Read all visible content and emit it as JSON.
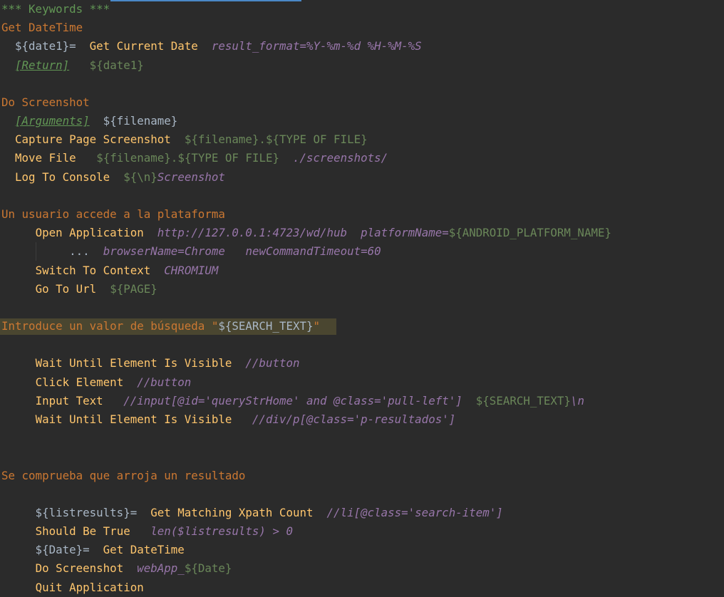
{
  "editor": {
    "lines": [
      {
        "name": "section-header-keywords",
        "segments": [
          {
            "text": "*** Keywords ***",
            "cls": "c-section"
          }
        ]
      },
      {
        "name": "keyword-get-datetime",
        "segments": [
          {
            "text": "Get DateTime",
            "cls": "c-kw"
          }
        ]
      },
      {
        "name": "line-date1-assign",
        "segments": [
          {
            "text": "  ${date1}=  ",
            "cls": "c-var"
          },
          {
            "text": "Get Current Date",
            "cls": "c-call"
          },
          {
            "text": "  ",
            "cls": "c-var"
          },
          {
            "text": "result_format=%Y-%m-%d %H-%M-%S",
            "cls": "c-arg"
          }
        ]
      },
      {
        "name": "line-return",
        "segments": [
          {
            "text": "  ",
            "cls": "c-var"
          },
          {
            "text": "[Return]",
            "cls": "c-setting"
          },
          {
            "text": "   ",
            "cls": "c-var"
          },
          {
            "text": "${date1}",
            "cls": "c-varg"
          }
        ]
      },
      {
        "name": "blank-1",
        "segments": [
          {
            "text": "",
            "cls": "c-var"
          }
        ]
      },
      {
        "name": "keyword-do-screenshot",
        "segments": [
          {
            "text": "Do Screenshot",
            "cls": "c-kw"
          }
        ]
      },
      {
        "name": "line-arguments",
        "segments": [
          {
            "text": "  ",
            "cls": "c-var"
          },
          {
            "text": "[Arguments]",
            "cls": "c-setting"
          },
          {
            "text": "  ${filename}",
            "cls": "c-var"
          }
        ]
      },
      {
        "name": "line-capture-page-screenshot",
        "segments": [
          {
            "text": "  ",
            "cls": "c-var"
          },
          {
            "text": "Capture Page Screenshot",
            "cls": "c-call"
          },
          {
            "text": "  ",
            "cls": "c-var"
          },
          {
            "text": "${filename}.${TYPE OF FILE}",
            "cls": "c-varg"
          }
        ]
      },
      {
        "name": "line-move-file",
        "segments": [
          {
            "text": "  ",
            "cls": "c-var"
          },
          {
            "text": "Move File",
            "cls": "c-call"
          },
          {
            "text": "   ",
            "cls": "c-var"
          },
          {
            "text": "${filename}.${TYPE OF FILE}",
            "cls": "c-varg"
          },
          {
            "text": "  ",
            "cls": "c-var"
          },
          {
            "text": "./screenshots/",
            "cls": "c-arg"
          }
        ]
      },
      {
        "name": "line-log-to-console",
        "segments": [
          {
            "text": "  ",
            "cls": "c-var"
          },
          {
            "text": "Log To Console",
            "cls": "c-call"
          },
          {
            "text": "  ",
            "cls": "c-var"
          },
          {
            "text": "${\\n}",
            "cls": "c-varg"
          },
          {
            "text": "Screenshot",
            "cls": "c-arg"
          }
        ]
      },
      {
        "name": "blank-2",
        "segments": [
          {
            "text": "",
            "cls": "c-var"
          }
        ]
      },
      {
        "name": "keyword-usuario-accede",
        "segments": [
          {
            "text": "Un usuario accede a la plataforma",
            "cls": "c-kw"
          }
        ]
      },
      {
        "name": "line-open-application",
        "segments": [
          {
            "text": "     ",
            "cls": "c-var"
          },
          {
            "text": "Open Application",
            "cls": "c-call"
          },
          {
            "text": "  ",
            "cls": "c-var"
          },
          {
            "text": "http://127.0.0.1:4723/wd/hub",
            "cls": "c-arg"
          },
          {
            "text": "  ",
            "cls": "c-var"
          },
          {
            "text": "platformName=",
            "cls": "c-arg"
          },
          {
            "text": "${ANDROID_PLATFORM_NAME}",
            "cls": "c-varg"
          }
        ]
      },
      {
        "name": "line-continuation",
        "segments": [
          {
            "text": "          ",
            "cls": "c-var"
          },
          {
            "text": "...",
            "cls": "c-ellipsis"
          },
          {
            "text": "  ",
            "cls": "c-var"
          },
          {
            "text": "browserName=Chrome",
            "cls": "c-arg"
          },
          {
            "text": "   ",
            "cls": "c-var"
          },
          {
            "text": "newCommandTimeout=60",
            "cls": "c-arg"
          }
        ]
      },
      {
        "name": "line-switch-context",
        "segments": [
          {
            "text": "     ",
            "cls": "c-var"
          },
          {
            "text": "Switch To Context",
            "cls": "c-call"
          },
          {
            "text": "  ",
            "cls": "c-var"
          },
          {
            "text": "CHROMIUM",
            "cls": "c-arg"
          }
        ]
      },
      {
        "name": "line-go-to-url",
        "segments": [
          {
            "text": "     ",
            "cls": "c-var"
          },
          {
            "text": "Go To Url",
            "cls": "c-call"
          },
          {
            "text": "  ",
            "cls": "c-var"
          },
          {
            "text": "${PAGE}",
            "cls": "c-varg"
          }
        ]
      },
      {
        "name": "blank-3",
        "segments": [
          {
            "text": "",
            "cls": "c-var"
          }
        ]
      },
      {
        "name": "keyword-introduce-valor",
        "segments": [
          {
            "text": "Introduce un valor de búsqueda \"",
            "cls": "c-kw"
          },
          {
            "text": "${SEARCH_TEXT}",
            "cls": "c-lit"
          },
          {
            "text": "\"",
            "cls": "c-kw"
          }
        ]
      },
      {
        "name": "blank-4",
        "segments": [
          {
            "text": "",
            "cls": "c-var"
          }
        ]
      },
      {
        "name": "line-wait-until-visible-1",
        "segments": [
          {
            "text": "     ",
            "cls": "c-var"
          },
          {
            "text": "Wait Until Element Is Visible",
            "cls": "c-call"
          },
          {
            "text": "  ",
            "cls": "c-var"
          },
          {
            "text": "//button",
            "cls": "c-arg"
          }
        ]
      },
      {
        "name": "line-click-element",
        "segments": [
          {
            "text": "     ",
            "cls": "c-var"
          },
          {
            "text": "Click Element",
            "cls": "c-call"
          },
          {
            "text": "  ",
            "cls": "c-var"
          },
          {
            "text": "//button",
            "cls": "c-arg"
          }
        ]
      },
      {
        "name": "line-input-text",
        "segments": [
          {
            "text": "     ",
            "cls": "c-var"
          },
          {
            "text": "Input Text",
            "cls": "c-call"
          },
          {
            "text": "   ",
            "cls": "c-var"
          },
          {
            "text": "//input[@id='queryStrHome' and @class='pull-left']",
            "cls": "c-arg"
          },
          {
            "text": "  ",
            "cls": "c-var"
          },
          {
            "text": "${SEARCH_TEXT}",
            "cls": "c-varg"
          },
          {
            "text": "\\n",
            "cls": "c-arg"
          }
        ]
      },
      {
        "name": "line-wait-until-visible-2",
        "segments": [
          {
            "text": "     ",
            "cls": "c-var"
          },
          {
            "text": "Wait Until Element Is Visible",
            "cls": "c-call"
          },
          {
            "text": "   ",
            "cls": "c-var"
          },
          {
            "text": "//div/p[@class='p-resultados']",
            "cls": "c-arg"
          }
        ]
      },
      {
        "name": "blank-5",
        "segments": [
          {
            "text": "",
            "cls": "c-var"
          }
        ]
      },
      {
        "name": "blank-6",
        "segments": [
          {
            "text": "",
            "cls": "c-var"
          }
        ]
      },
      {
        "name": "keyword-se-comprueba",
        "segments": [
          {
            "text": "Se comprueba que arroja un resultado",
            "cls": "c-kw"
          }
        ]
      },
      {
        "name": "blank-7",
        "segments": [
          {
            "text": "",
            "cls": "c-var"
          }
        ]
      },
      {
        "name": "line-listresults-assign",
        "segments": [
          {
            "text": "     ${listresults}=  ",
            "cls": "c-var"
          },
          {
            "text": "Get Matching Xpath Count",
            "cls": "c-call"
          },
          {
            "text": "  ",
            "cls": "c-var"
          },
          {
            "text": "//li[@class='search-item']",
            "cls": "c-arg"
          }
        ]
      },
      {
        "name": "line-should-be-true",
        "segments": [
          {
            "text": "     ",
            "cls": "c-var"
          },
          {
            "text": "Should Be True",
            "cls": "c-call"
          },
          {
            "text": "   ",
            "cls": "c-var"
          },
          {
            "text": "len($listresults) > 0",
            "cls": "c-arg"
          }
        ]
      },
      {
        "name": "line-date-assign",
        "segments": [
          {
            "text": "     ${Date}=  ",
            "cls": "c-var"
          },
          {
            "text": "Get DateTime",
            "cls": "c-call"
          }
        ]
      },
      {
        "name": "line-do-screenshot-call",
        "segments": [
          {
            "text": "     ",
            "cls": "c-var"
          },
          {
            "text": "Do Screenshot",
            "cls": "c-call"
          },
          {
            "text": "  ",
            "cls": "c-var"
          },
          {
            "text": "webApp_",
            "cls": "c-arg"
          },
          {
            "text": "${Date}",
            "cls": "c-varg"
          }
        ]
      },
      {
        "name": "line-quit-application",
        "segments": [
          {
            "text": "     ",
            "cls": "c-var"
          },
          {
            "text": "Quit Application",
            "cls": "c-call"
          }
        ]
      }
    ]
  }
}
